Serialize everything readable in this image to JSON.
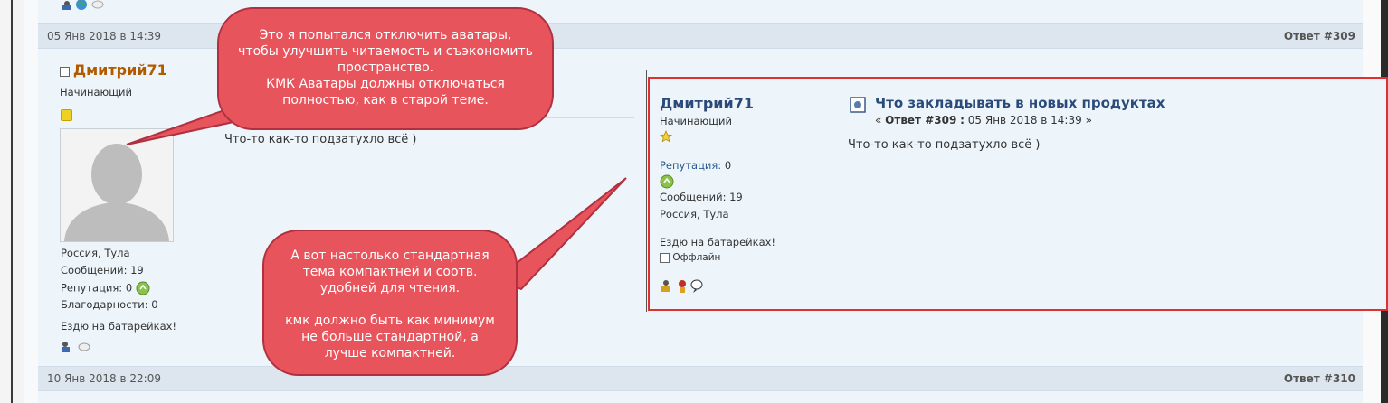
{
  "post309": {
    "date": "05 Янв 2018 в 14:39",
    "reply_label": "Ответ #309",
    "author": {
      "name": "Дмитрий71",
      "rank": "Начинающий",
      "location": "Россия, Тула",
      "messages": "Сообщений: 19",
      "reputation": "Репутация: 0",
      "thanks": "Благодарности: 0",
      "signature": "Ездю на батарейках!"
    },
    "body": "Что-то как-то подзатухло всё )"
  },
  "post310": {
    "date": "10 Янв 2018 в 22:09",
    "reply_label": "Ответ #310"
  },
  "callout_top": {
    "lines": [
      "Это я попытался отключить аватары,",
      "чтобы улучшить читаемость и съэкономить",
      "пространство.",
      "КМК Аватары должны отключаться",
      "полностью, как в старой теме."
    ]
  },
  "callout_bottom": {
    "lines": [
      "А вот настолько стандартная",
      "тема компактней и соотв.",
      "удобней для чтения.",
      "",
      "кмк должно быть как минимум",
      "не больше стандартной, а",
      "лучше компактней."
    ]
  },
  "standard_post": {
    "author": "Дмитрий71",
    "rank": "Начинающий",
    "reputation_label": "Репутация:",
    "reputation_value": "0",
    "messages": "Сообщений: 19",
    "location": "Россия, Тула",
    "signature": "Ездю на батарейках!",
    "status": "Оффлайн",
    "title": "Что закладывать в новых продуктах",
    "meta_prefix": "«",
    "meta_reply": "Ответ #309",
    "meta_sep": ":",
    "meta_date": "05 Янв 2018 в 14:39",
    "meta_suffix": "»",
    "body": "Что-то как-то подзатухло всё )"
  },
  "colors": {
    "callout_fill": "#e8545c",
    "highlight_border": "#e03030",
    "username_orange": "#b25a00",
    "username_blue": "#2a4a7a"
  }
}
